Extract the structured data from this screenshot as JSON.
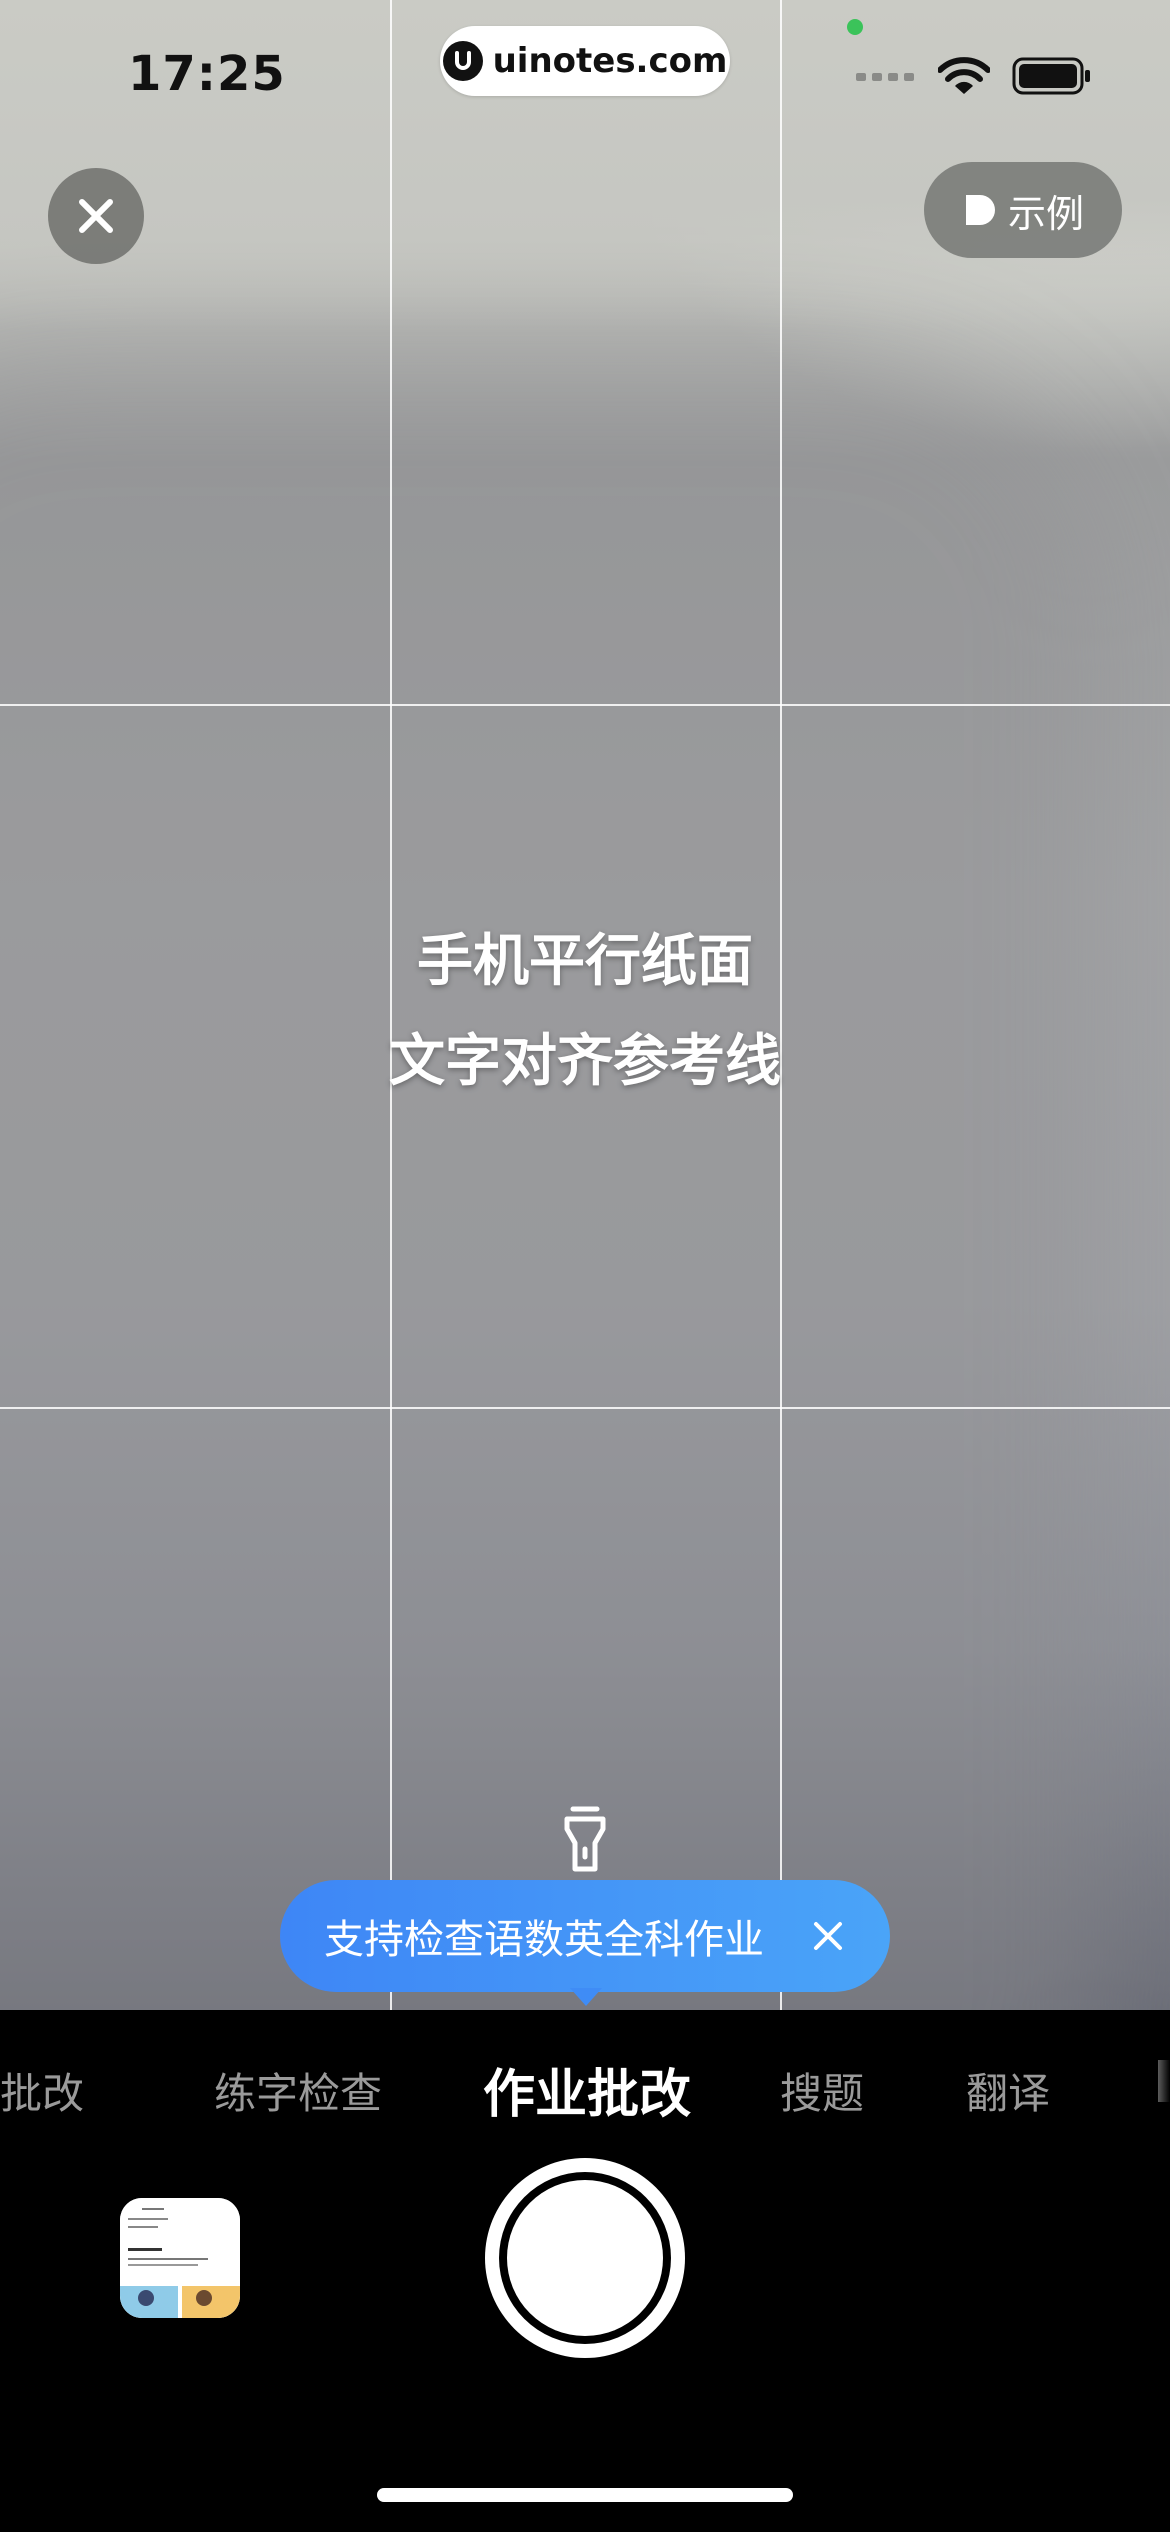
{
  "status_bar": {
    "time": "17:25",
    "url": "uinotes.com"
  },
  "toolbar": {
    "close_icon": "close-icon",
    "example_label": "示例"
  },
  "guide": {
    "line1": "手机平行纸面",
    "line2": "文字对齐参考线"
  },
  "tip": {
    "text": "支持检查语数英全科作业"
  },
  "modes": [
    {
      "label": "批改",
      "active": false
    },
    {
      "label": "练字检查",
      "active": false
    },
    {
      "label": "作业批改",
      "active": true
    },
    {
      "label": "搜题",
      "active": false
    },
    {
      "label": "翻译",
      "active": false
    }
  ],
  "colors": {
    "tip_bubble": "#3e86f6",
    "background": "#000000"
  }
}
